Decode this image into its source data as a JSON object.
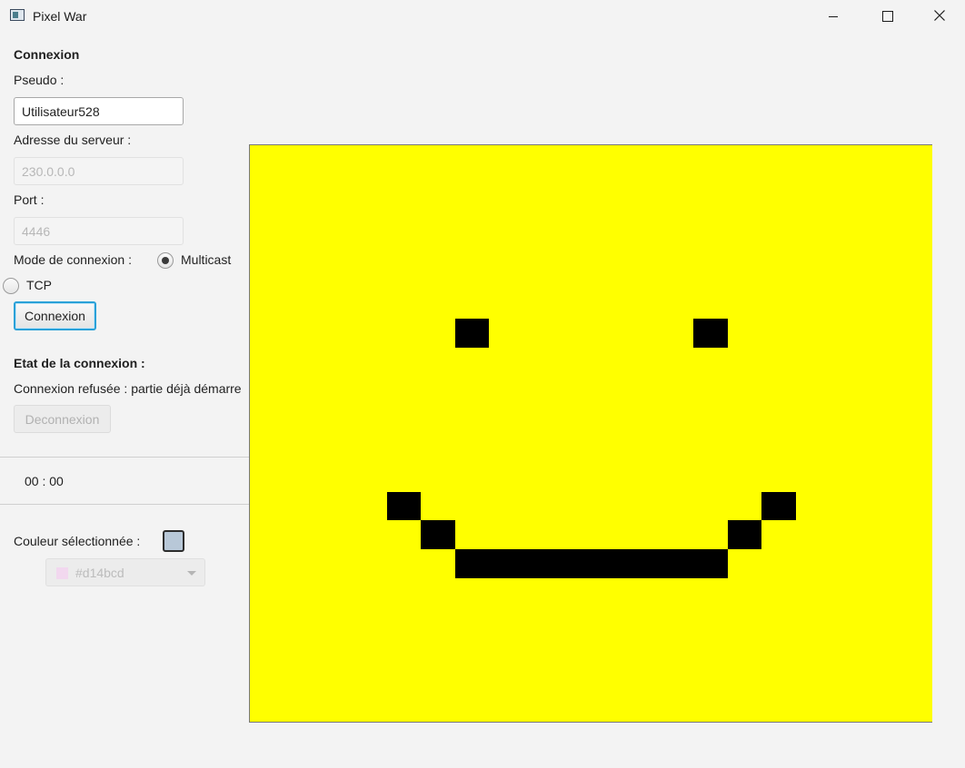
{
  "window": {
    "title": "Pixel War",
    "icon": "app-window-icon"
  },
  "connection": {
    "heading": "Connexion",
    "pseudo_label": "Pseudo :",
    "pseudo_value": "Utilisateur528",
    "server_label": "Adresse du serveur :",
    "server_value": "230.0.0.0",
    "port_label": "Port :",
    "port_value": "4446",
    "mode_label": "Mode de connexion :",
    "mode_options": [
      {
        "label": "Multicast",
        "selected": true
      },
      {
        "label": "TCP",
        "selected": false
      }
    ],
    "connect_button": "Connexion"
  },
  "status": {
    "heading": "Etat de la connexion :",
    "message": "Connexion refusée : partie déjà démarre",
    "disconnect_button": "Deconnexion"
  },
  "timer": "00 : 00",
  "color": {
    "label": "Couleur sélectionnée :",
    "selected_swatch": "#b8c8d8",
    "picker_value": "#d14bcd",
    "picker_chip": "#f2d8ef"
  },
  "canvas": {
    "grid_cols": 20,
    "grid_rows": 20,
    "background": "#ffff00",
    "pixel_color": "#000000",
    "black_pixels": [
      [
        6,
        6
      ],
      [
        13,
        6
      ],
      [
        4,
        12
      ],
      [
        15,
        12
      ],
      [
        5,
        13
      ],
      [
        14,
        13
      ],
      [
        6,
        14
      ],
      [
        7,
        14
      ],
      [
        8,
        14
      ],
      [
        9,
        14
      ],
      [
        10,
        14
      ],
      [
        11,
        14
      ],
      [
        12,
        14
      ],
      [
        13,
        14
      ]
    ]
  }
}
